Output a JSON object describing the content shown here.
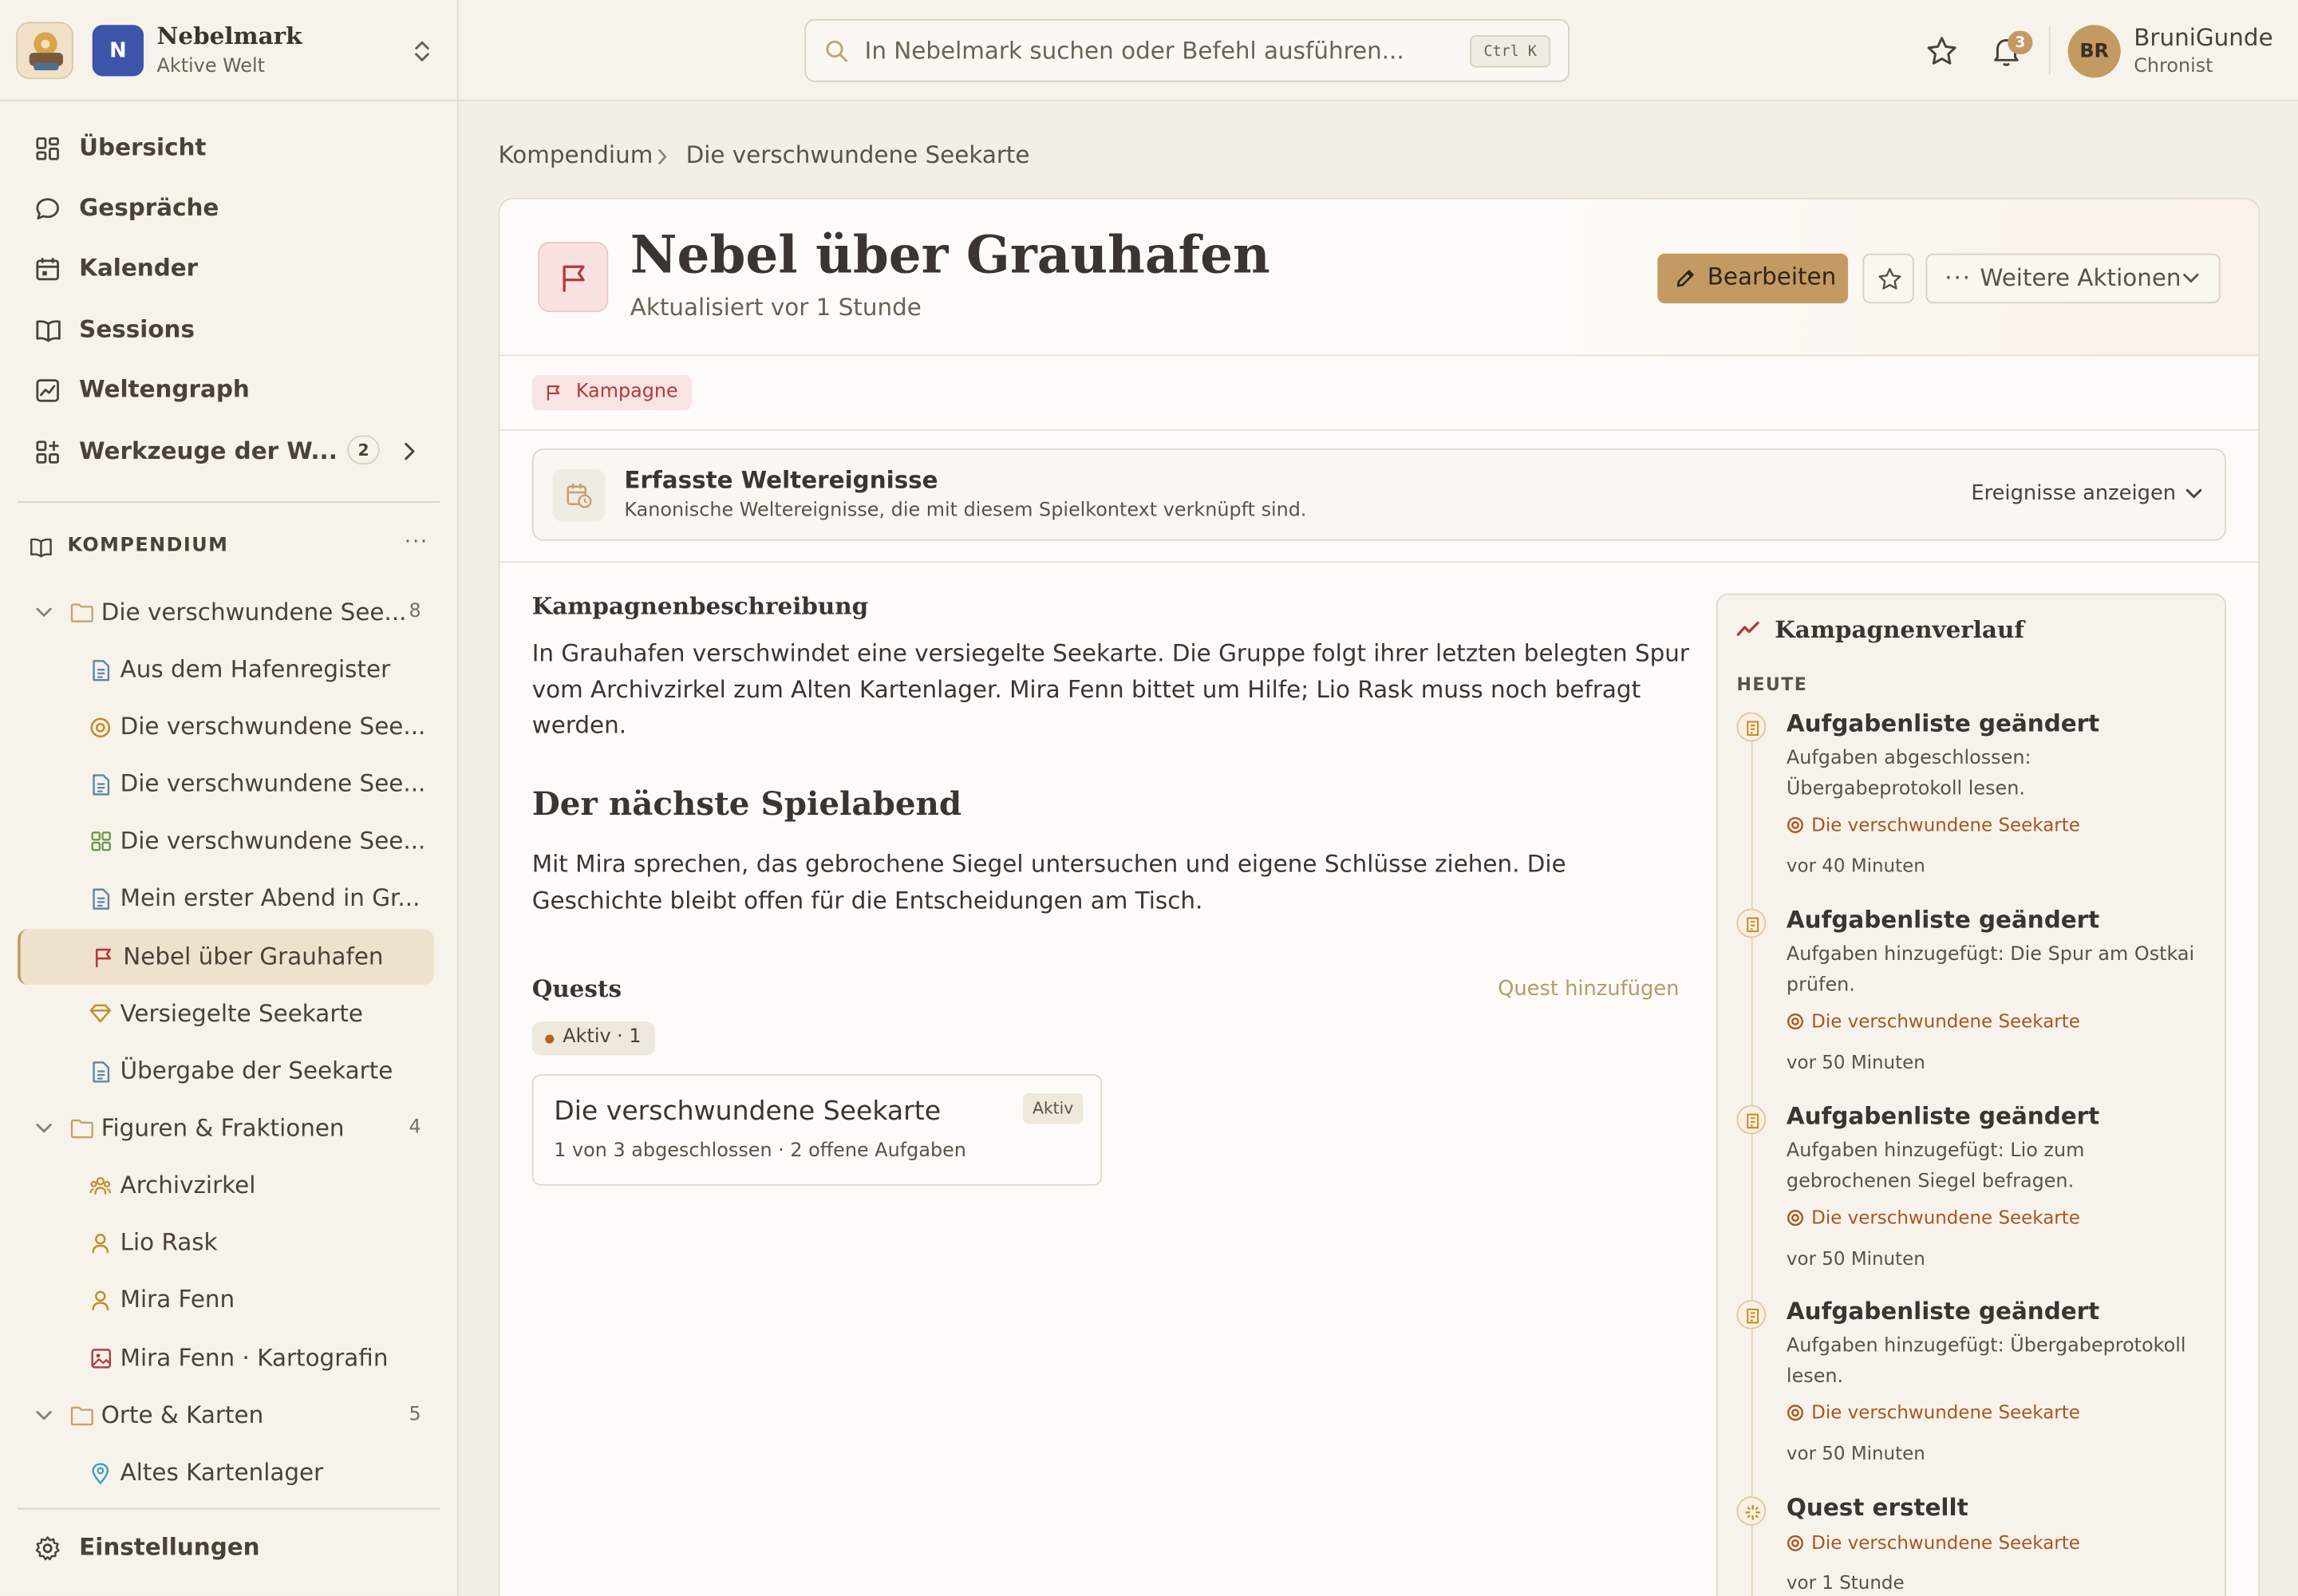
{
  "workspace": {
    "badge": "N",
    "name": "Nebelmark",
    "subtitle": "Aktive Welt"
  },
  "nav": [
    {
      "label": "Übersicht",
      "icon": "dashboard-icon"
    },
    {
      "label": "Gespräche",
      "icon": "chat-icon"
    },
    {
      "label": "Kalender",
      "icon": "calendar-icon"
    },
    {
      "label": "Sessions",
      "icon": "book-icon"
    },
    {
      "label": "Weltengraph",
      "icon": "graph-icon"
    },
    {
      "label": "Werkzeuge der W...",
      "icon": "tools-icon",
      "badge": "2"
    }
  ],
  "compendium": {
    "title": "KOMPENDIUM",
    "more": "···",
    "items": [
      {
        "label": "Die verschwundene See...",
        "count": "8",
        "type": "folder"
      },
      {
        "label": "Aus dem Hafenregister",
        "type": "document"
      },
      {
        "label": "Die verschwundene See...",
        "type": "quest"
      },
      {
        "label": "Die verschwundene See...",
        "type": "document"
      },
      {
        "label": "Die verschwundene See...",
        "type": "board"
      },
      {
        "label": "Mein erster Abend in Gr...",
        "type": "document"
      },
      {
        "label": "Nebel über Grauhafen",
        "type": "campaign"
      },
      {
        "label": "Versiegelte Seekarte",
        "type": "item"
      },
      {
        "label": "Übergabe der Seekarte",
        "type": "document"
      },
      {
        "label": "Figuren & Fraktionen",
        "count": "4",
        "type": "folder"
      },
      {
        "label": "Archivzirkel",
        "type": "faction"
      },
      {
        "label": "Lio Rask",
        "type": "person"
      },
      {
        "label": "Mira Fenn",
        "type": "person"
      },
      {
        "label": "Mira Fenn · Kartografin",
        "type": "image"
      },
      {
        "label": "Orte & Karten",
        "count": "5",
        "type": "folder"
      },
      {
        "label": "Altes Kartenlager",
        "type": "location"
      }
    ]
  },
  "settings_label": "Einstellungen",
  "topbar": {
    "search_placeholder": "In Nebelmark suchen oder Befehl ausführen...",
    "shortcut": "Ctrl K",
    "notifications": "3",
    "user_initials": "BR",
    "user_name": "BruniGunde",
    "user_role": "Chronist"
  },
  "breadcrumb": {
    "root": "Kompendium",
    "current": "Die verschwundene Seekarte"
  },
  "page": {
    "title": "Nebel über Grauhafen",
    "updated": "Aktualisiert vor 1 Stunde",
    "edit_label": "Bearbeiten",
    "more_label": "Weitere Aktionen",
    "tag": "Kampagne"
  },
  "events": {
    "title": "Erfasste Weltereignisse",
    "subtitle": "Kanonische Weltereignisse, die mit diesem Spielkontext verknüpft sind.",
    "show_label": "Ereignisse anzeigen"
  },
  "content": {
    "desc_heading": "Kampagnenbeschreibung",
    "desc_text": "In Grauhafen verschwindet eine versiegelte Seekarte. Die Gruppe folgt ihrer letzten belegten Spur vom Archivzirkel zum Alten Kartenlager. Mira Fenn bittet um Hilfe; Lio Rask muss noch befragt werden.",
    "next_heading": "Der nächste Spielabend",
    "next_text": "Mit Mira sprechen, das gebrochene Siegel untersuchen und eigene Schlüsse ziehen. Die Geschichte bleibt offen für die Entscheidungen am Tisch."
  },
  "quests": {
    "heading": "Quests",
    "add_label": "Quest hinzufügen",
    "filter": "Aktiv · 1",
    "card": {
      "title": "Die verschwundene Seekarte",
      "badge": "Aktiv",
      "progress": "1 von 3 abgeschlossen · 2 offene Aufgaben"
    }
  },
  "timeline": {
    "title": "Kampagnenverlauf",
    "group": "HEUTE",
    "entries": [
      {
        "title": "Aufgabenliste geändert",
        "desc": "Aufgaben abgeschlossen: Übergabeprotokoll lesen.",
        "link": "Die verschwundene Seekarte",
        "time": "vor 40 Minuten"
      },
      {
        "title": "Aufgabenliste geändert",
        "desc": "Aufgaben hinzugefügt: Die Spur am Ostkai prüfen.",
        "link": "Die verschwundene Seekarte",
        "time": "vor 50 Minuten"
      },
      {
        "title": "Aufgabenliste geändert",
        "desc": "Aufgaben hinzugefügt: Lio zum gebrochenen Siegel befragen.",
        "link": "Die verschwundene Seekarte",
        "time": "vor 50 Minuten"
      },
      {
        "title": "Aufgabenliste geändert",
        "desc": "Aufgaben hinzugefügt: Übergabeprotokoll lesen.",
        "link": "Die verschwundene Seekarte",
        "time": "vor 50 Minuten"
      },
      {
        "title": "Quest erstellt",
        "desc": "",
        "link": "Die verschwundene Seekarte",
        "time": "vor 1 Stunde"
      }
    ]
  },
  "colors": {
    "accent": "#c49a63",
    "workspace": "#3c55a8",
    "campaign": "#b23a3a",
    "link": "#a8561f",
    "background": "#f3efe7"
  }
}
